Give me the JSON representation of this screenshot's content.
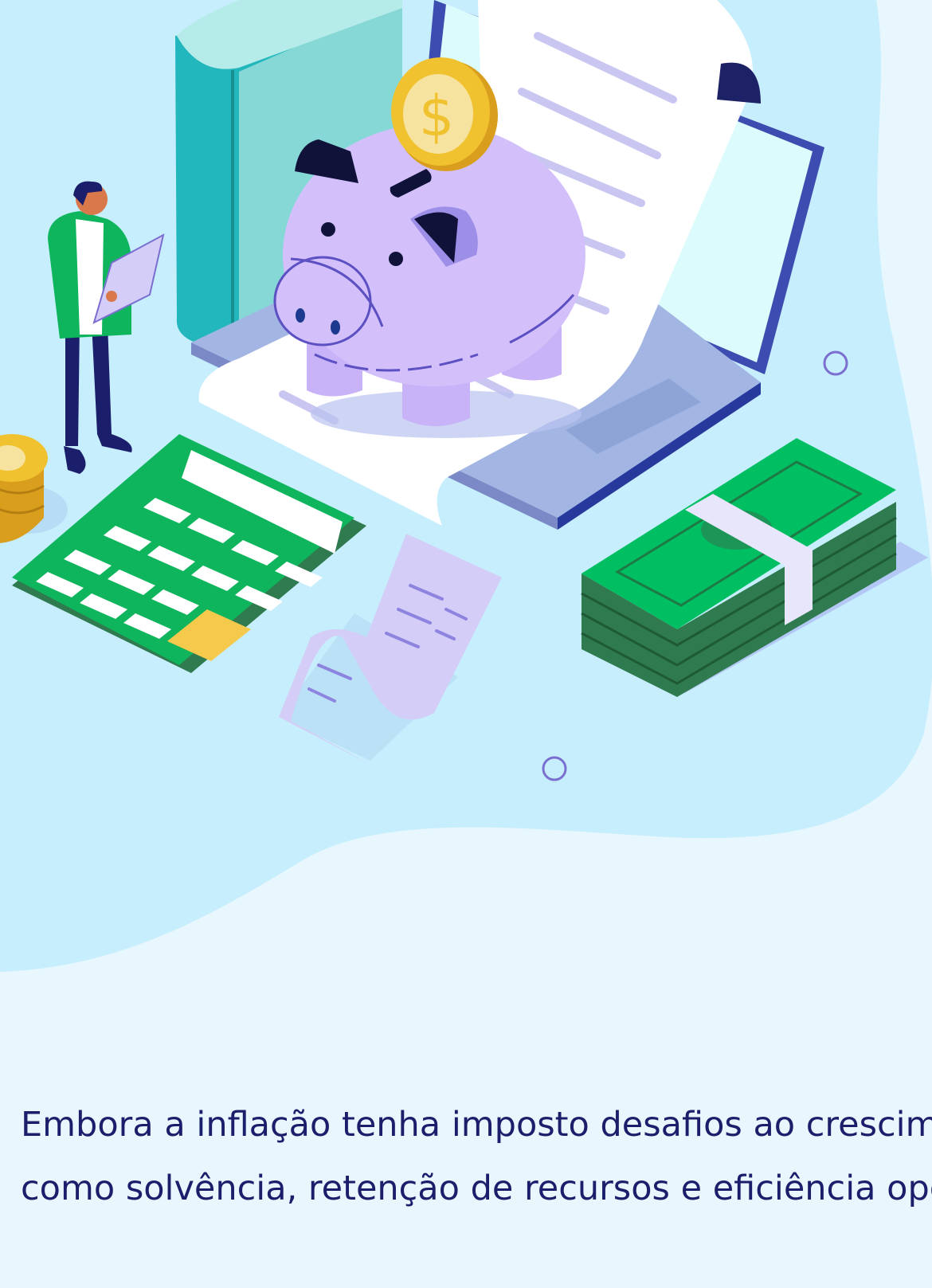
{
  "illustration": {
    "subject": "finance-savings-illustration",
    "colors": {
      "page_background": "#e8f7fd",
      "blob": "#c7eefc",
      "piggy": "#d3c0fb",
      "calculator": "#0fb55c",
      "money": "#00bf63",
      "coin": "#f0c230",
      "book": "#22b7bc",
      "laptop": "#3c4cb0"
    }
  },
  "article": {
    "paragraph_line_1": "Embora a inflação tenha imposto desafios ao crescime",
    "paragraph_line_2": "como solvência, retenção de recursos e eficiência ope"
  }
}
